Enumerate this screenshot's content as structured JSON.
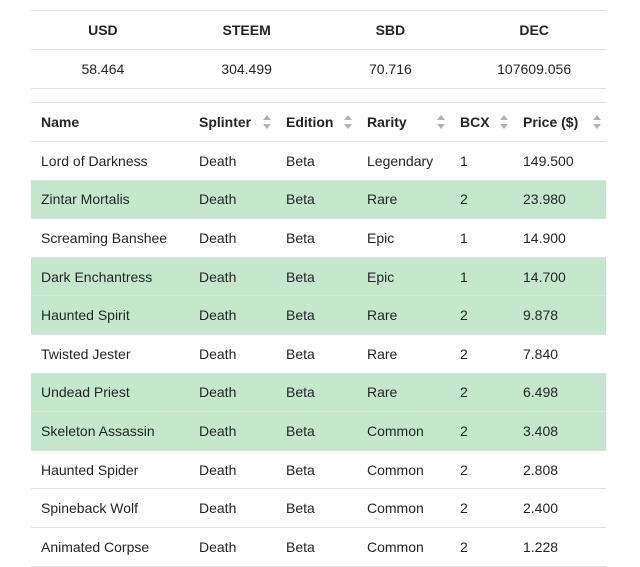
{
  "summary": {
    "headers": [
      "USD",
      "STEEM",
      "SBD",
      "DEC"
    ],
    "values": [
      "58.464",
      "304.499",
      "70.716",
      "107609.056"
    ]
  },
  "cards": {
    "columns": [
      "Name",
      "Splinter",
      "Edition",
      "Rarity",
      "BCX",
      "Price ($)"
    ],
    "rows": [
      {
        "name": "Lord of Darkness",
        "splinter": "Death",
        "edition": "Beta",
        "rarity": "Legendary",
        "bcx": "1",
        "price": "149.500",
        "highlight": false
      },
      {
        "name": "Zintar Mortalis",
        "splinter": "Death",
        "edition": "Beta",
        "rarity": "Rare",
        "bcx": "2",
        "price": "23.980",
        "highlight": true
      },
      {
        "name": "Screaming Banshee",
        "splinter": "Death",
        "edition": "Beta",
        "rarity": "Epic",
        "bcx": "1",
        "price": "14.900",
        "highlight": false
      },
      {
        "name": "Dark Enchantress",
        "splinter": "Death",
        "edition": "Beta",
        "rarity": "Epic",
        "bcx": "1",
        "price": "14.700",
        "highlight": true
      },
      {
        "name": "Haunted Spirit",
        "splinter": "Death",
        "edition": "Beta",
        "rarity": "Rare",
        "bcx": "2",
        "price": "9.878",
        "highlight": true
      },
      {
        "name": "Twisted Jester",
        "splinter": "Death",
        "edition": "Beta",
        "rarity": "Rare",
        "bcx": "2",
        "price": "7.840",
        "highlight": false
      },
      {
        "name": "Undead Priest",
        "splinter": "Death",
        "edition": "Beta",
        "rarity": "Rare",
        "bcx": "2",
        "price": "6.498",
        "highlight": true
      },
      {
        "name": "Skeleton Assassin",
        "splinter": "Death",
        "edition": "Beta",
        "rarity": "Common",
        "bcx": "2",
        "price": "3.408",
        "highlight": true
      },
      {
        "name": "Haunted Spider",
        "splinter": "Death",
        "edition": "Beta",
        "rarity": "Common",
        "bcx": "2",
        "price": "2.808",
        "highlight": false
      },
      {
        "name": "Spineback Wolf",
        "splinter": "Death",
        "edition": "Beta",
        "rarity": "Common",
        "bcx": "2",
        "price": "2.400",
        "highlight": false
      },
      {
        "name": "Animated Corpse",
        "splinter": "Death",
        "edition": "Beta",
        "rarity": "Common",
        "bcx": "2",
        "price": "1.228",
        "highlight": false
      }
    ]
  },
  "colors": {
    "highlight_row": "#c5e8cc",
    "border": "#dee2e6",
    "sort_icon": "#aeb3b8"
  },
  "icons": {
    "sort": "sort-both-icon"
  }
}
